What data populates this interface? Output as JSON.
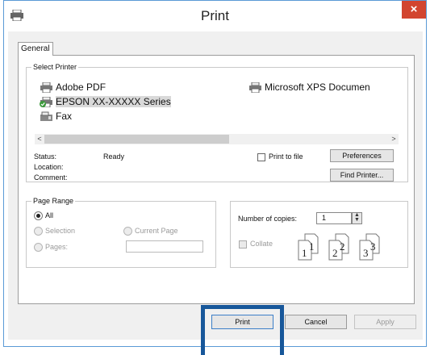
{
  "window": {
    "title": "Print",
    "close_label": "×",
    "tab_label": "General"
  },
  "select_printer": {
    "label": "Select Printer",
    "printers": [
      {
        "name": "Adobe PDF",
        "icon": "printer-icon"
      },
      {
        "name": "Microsoft XPS Documen",
        "icon": "printer-icon"
      },
      {
        "name": "EPSON XX-XXXXX Series",
        "icon": "printer-checked-icon",
        "selected": true
      },
      {
        "name": "Fax",
        "icon": "fax-icon"
      }
    ],
    "scroll_left": "<",
    "scroll_right": ">"
  },
  "status": {
    "status_label": "Status:",
    "status_value": "Ready",
    "location_label": "Location:",
    "comment_label": "Comment:",
    "print_to_file_label": "Print to file",
    "preferences_label": "Preferences",
    "find_printer_label": "Find Printer..."
  },
  "page_range": {
    "label": "Page Range",
    "all_label": "All",
    "selection_label": "Selection",
    "current_page_label": "Current Page",
    "pages_label": "Pages:",
    "selected": "All"
  },
  "copies": {
    "label": "Number of copies:",
    "value": "1",
    "collate_label": "Collate",
    "page_numbers": [
      "1",
      "1",
      "2",
      "2",
      "3",
      "3"
    ]
  },
  "buttons": {
    "print_label": "Print",
    "cancel_label": "Cancel",
    "apply_label": "Apply"
  },
  "colors": {
    "close_button": "#d2452f",
    "highlight_border": "#17579a",
    "window_border": "#5a9ad6"
  }
}
